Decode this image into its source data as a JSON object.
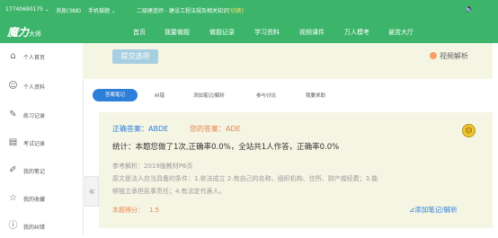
{
  "topbar": {
    "phone": "17740690175",
    "messages": "消息(388)",
    "mobile": "手机做题",
    "exam_prefix": "二级建造师 - 建设工程法规及相关知识",
    "exam_tag": "[切换]"
  },
  "nav": {
    "logo": "魔力",
    "logo_sub": "大师",
    "items": [
      "首页",
      "我要做题",
      "做题记录",
      "学习资料",
      "视频课件",
      "万人模考",
      "悬赏大厅"
    ]
  },
  "sidebar": {
    "items": [
      {
        "label": "个人首页",
        "icon": "home-icon"
      },
      {
        "label": "个人资料",
        "icon": "profile-icon"
      },
      {
        "label": "练习记录",
        "icon": "practice-icon"
      },
      {
        "label": "考试记录",
        "icon": "exam-icon"
      },
      {
        "label": "我的笔记",
        "icon": "note-icon"
      },
      {
        "label": "我的收藏",
        "icon": "star-icon"
      },
      {
        "label": "我的纠错",
        "icon": "error-icon"
      }
    ]
  },
  "content": {
    "submit_label": "提交选项",
    "video_label": "视频解析",
    "tabs": [
      "答案笔记",
      "纠错",
      "添加笔记/解析",
      "参与讨论",
      "我要求助"
    ],
    "answer": {
      "correct": "正确答案：ABDE",
      "mine": "您的答案：ADE",
      "stats": "统计：本题您做了1次,正确率0.0%，全站共1人作答，正确率0.0%",
      "reference": "参考解析：2019版教材P6页",
      "body_line1": "原文是法人应当具备的条件：1.依法成立 2.有自己的名称、组织机构、住所、财产或经费；3.能",
      "body_line2": "够独立承担民事责任；4.有法定代表人。",
      "score_label": "本题得分：",
      "score_value": "1.5",
      "add_note": "⊿添加笔记/解析"
    }
  },
  "colors": {
    "brand_green": "#3cb46a",
    "accent_blue": "#2d7fd8",
    "orange": "#e9844a"
  }
}
